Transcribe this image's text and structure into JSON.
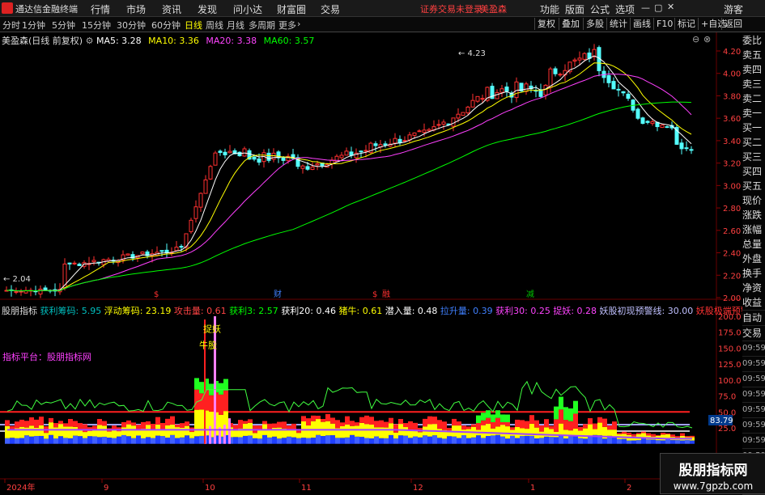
{
  "app": {
    "title": "通达信金融终端",
    "warning": "证券交易未登录",
    "stock_name": "美盈森"
  },
  "menu": [
    "行情",
    "市场",
    "资讯",
    "发现",
    "问小达",
    "财富圈",
    "交易"
  ],
  "top_right": [
    "功能",
    "版面",
    "公式",
    "选项",
    "游客"
  ],
  "periods": [
    {
      "label": "分时",
      "active": false
    },
    {
      "label": "1分钟",
      "active": false
    },
    {
      "label": "5分钟",
      "active": false
    },
    {
      "label": "15分钟",
      "active": false
    },
    {
      "label": "30分钟",
      "active": false
    },
    {
      "label": "60分钟",
      "active": false
    },
    {
      "label": "日线",
      "active": true
    },
    {
      "label": "周线",
      "active": false
    },
    {
      "label": "月线",
      "active": false
    },
    {
      "label": "多周期",
      "active": false
    },
    {
      "label": "更多",
      "active": false
    }
  ],
  "toolbar_right": [
    "复权",
    "叠加",
    "多股",
    "统计",
    "画线",
    "F10",
    "标记",
    "+自选",
    "返回"
  ],
  "main_legend": {
    "title": "美盈森(日线 前复权)",
    "ma": [
      {
        "label": "MA5: 3.28",
        "color": "#ffffff"
      },
      {
        "label": "MA10: 3.36",
        "color": "#ffff00"
      },
      {
        "label": "MA20: 3.38",
        "color": "#ff40ff"
      },
      {
        "label": "MA60: 3.57",
        "color": "#00ff00"
      }
    ]
  },
  "price_axis": [
    "4.20",
    "4.00",
    "3.80",
    "3.60",
    "3.40",
    "3.20",
    "3.00",
    "2.80",
    "2.60",
    "2.40",
    "2.20",
    "2.00"
  ],
  "annotations": {
    "high": "4.23",
    "low": "2.04"
  },
  "event_marks": [
    {
      "label": "$",
      "color": "#ff3030"
    },
    {
      "label": "财",
      "color": "#4080ff"
    },
    {
      "label": "$",
      "color": "#ff3030"
    },
    {
      "label": "融",
      "color": "#ff3030"
    },
    {
      "label": "减",
      "color": "#00c000"
    }
  ],
  "ind_legend": {
    "name": "股朋指标",
    "items": [
      {
        "label": "获利筹码: 5.95",
        "color": "#00c0c0"
      },
      {
        "label": "浮动筹码: 23.19",
        "color": "#ffff00"
      },
      {
        "label": "攻击量: 0.61",
        "color": "#ff4040"
      },
      {
        "label": "获利3: 2.57",
        "color": "#00ff00"
      },
      {
        "label": "获利20: 0.46",
        "color": "#ffffff"
      },
      {
        "label": "猪牛: 0.61",
        "color": "#ffff00"
      },
      {
        "label": "潜入量: 0.48",
        "color": "#ffffff"
      },
      {
        "label": "拉升量: 0.39",
        "color": "#4080ff"
      },
      {
        "label": "获利30: 0.25",
        "color": "#ff40ff"
      },
      {
        "label": "捉妖: 0.28",
        "color": "#ff40ff"
      },
      {
        "label": "妖股初现预警线: 30.00",
        "color": "#c0c0ff"
      },
      {
        "label": "妖股极端预警线: 50.00",
        "color": "#ff3030"
      }
    ]
  },
  "ind_platform": "指标平台：股朋指标网",
  "ind_tags": {
    "zhuoyao": "捉妖",
    "niugu": "牛股"
  },
  "ind_axis": [
    "200.0",
    "175.0",
    "150.0",
    "125.0",
    "100.0",
    "75.0",
    "50.0",
    "25.0"
  ],
  "ind_cursor": "83.79",
  "date_axis": [
    "2024年",
    "9",
    "10",
    "11",
    "12",
    "1",
    "2"
  ],
  "side_panel": [
    "委比",
    "卖五",
    "卖四",
    "卖三",
    "卖二",
    "卖一",
    "买一",
    "买二",
    "买三",
    "买四",
    "买五",
    "现价",
    "涨跌",
    "涨幅",
    "总量",
    "外盘",
    "换手",
    "净资",
    "收益"
  ],
  "side_panel2": [
    "自动",
    "交易",
    "09:59",
    "09:59",
    "09:59",
    "09:59",
    "09:59",
    "09:59",
    "09:59",
    "09:59",
    "10:00",
    "10:00"
  ],
  "watermark": {
    "text": "股朋指标网",
    "url": "www.7gpzb.com"
  }
}
